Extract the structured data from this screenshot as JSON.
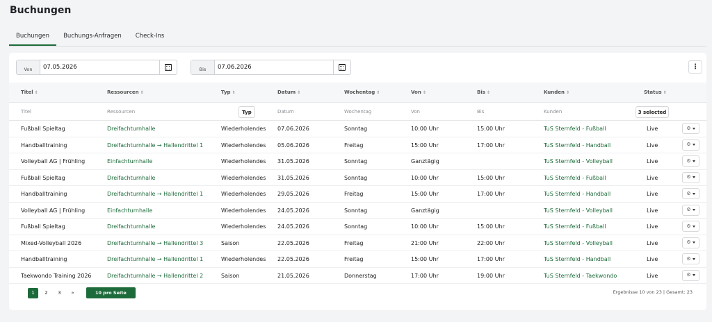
{
  "page": {
    "title": "Buchungen"
  },
  "tabs": [
    {
      "label": "Buchungen",
      "active": true
    },
    {
      "label": "Buchungs-Anfragen",
      "active": false
    },
    {
      "label": "Check-Ins",
      "active": false
    }
  ],
  "date_filters": {
    "from": {
      "prefix": "Von",
      "value": "07.05.2026"
    },
    "to": {
      "prefix": "Bis",
      "value": "07.06.2026"
    }
  },
  "more_menu_icon": "⋮",
  "table": {
    "columns": [
      "Titel",
      "Ressourcen",
      "Typ",
      "Datum",
      "Wochentag",
      "Von",
      "Bis",
      "Kunden",
      "Status"
    ],
    "filters": {
      "titel": "Titel",
      "ressourcen": "Ressourcen",
      "typ_button": "Typ",
      "datum": "Datum",
      "wochentag": "Wochentag",
      "von": "Von",
      "bis": "Bis",
      "kunden": "Kunden",
      "status_button": "3 selected"
    },
    "rows": [
      {
        "titel": "Fußball Spieltag",
        "ressourcen": "Dreifachturnhalle",
        "typ": "Wiederholendes",
        "datum": "07.06.2026",
        "wochentag": "Sonntag",
        "von": "10:00 Uhr",
        "bis": "15:00 Uhr",
        "kunden": "TuS Sternfeld - Fußball",
        "status": "Live"
      },
      {
        "titel": "Handballtraining",
        "ressourcen": "Dreifachturnhalle → Hallendrittel 1",
        "typ": "Wiederholendes",
        "datum": "05.06.2026",
        "wochentag": "Freitag",
        "von": "15:00 Uhr",
        "bis": "17:00 Uhr",
        "kunden": "TuS Sternfeld - Handball",
        "status": "Live"
      },
      {
        "titel": "Volleyball AG | Frühling",
        "ressourcen": "Einfachturnhalle",
        "typ": "Wiederholendes",
        "datum": "31.05.2026",
        "wochentag": "Sonntag",
        "von": "Ganztägig",
        "bis": "",
        "kunden": "TuS Sternfeld - Volleyball",
        "status": "Live"
      },
      {
        "titel": "Fußball Spieltag",
        "ressourcen": "Dreifachturnhalle",
        "typ": "Wiederholendes",
        "datum": "31.05.2026",
        "wochentag": "Sonntag",
        "von": "10:00 Uhr",
        "bis": "15:00 Uhr",
        "kunden": "TuS Sternfeld - Fußball",
        "status": "Live"
      },
      {
        "titel": "Handballtraining",
        "ressourcen": "Dreifachturnhalle → Hallendrittel 1",
        "typ": "Wiederholendes",
        "datum": "29.05.2026",
        "wochentag": "Freitag",
        "von": "15:00 Uhr",
        "bis": "17:00 Uhr",
        "kunden": "TuS Sternfeld - Handball",
        "status": "Live"
      },
      {
        "titel": "Volleyball AG | Frühling",
        "ressourcen": "Einfachturnhalle",
        "typ": "Wiederholendes",
        "datum": "24.05.2026",
        "wochentag": "Sonntag",
        "von": "Ganztägig",
        "bis": "",
        "kunden": "TuS Sternfeld - Volleyball",
        "status": "Live"
      },
      {
        "titel": "Fußball Spieltag",
        "ressourcen": "Dreifachturnhalle",
        "typ": "Wiederholendes",
        "datum": "24.05.2026",
        "wochentag": "Sonntag",
        "von": "10:00 Uhr",
        "bis": "15:00 Uhr",
        "kunden": "TuS Sternfeld - Fußball",
        "status": "Live"
      },
      {
        "titel": "Mixed-Volleyball 2026",
        "ressourcen": "Dreifachturnhalle → Hallendrittel 3",
        "typ": "Saison",
        "datum": "22.05.2026",
        "wochentag": "Freitag",
        "von": "21:00 Uhr",
        "bis": "22:00 Uhr",
        "kunden": "TuS Sternfeld - Volleyball",
        "status": "Live"
      },
      {
        "titel": "Handballtraining",
        "ressourcen": "Dreifachturnhalle → Hallendrittel 1",
        "typ": "Wiederholendes",
        "datum": "22.05.2026",
        "wochentag": "Freitag",
        "von": "15:00 Uhr",
        "bis": "17:00 Uhr",
        "kunden": "TuS Sternfeld - Handball",
        "status": "Live"
      },
      {
        "titel": "Taekwondo Training 2026",
        "ressourcen": "Dreifachturnhalle → Hallendrittel 2",
        "typ": "Saison",
        "datum": "21.05.2026",
        "wochentag": "Donnerstag",
        "von": "17:00 Uhr",
        "bis": "19:00 Uhr",
        "kunden": "TuS Sternfeld - Taekwondo",
        "status": "Live"
      }
    ]
  },
  "pagination": {
    "pages": [
      "1",
      "2",
      "3",
      "»"
    ],
    "active_page": "1",
    "per_page_label": "10 pro Seite",
    "results_text": "Ergebnisse 10 von 23 | Gesamt: 23"
  },
  "colors": {
    "accent": "#1d6b3a",
    "background": "#f3f4f5"
  },
  "icons": {
    "calendar": "calendar-icon",
    "gear": "gear-icon",
    "caret": "caret-down-icon",
    "sort": "sort-icon",
    "kebab": "kebab-menu-icon"
  }
}
